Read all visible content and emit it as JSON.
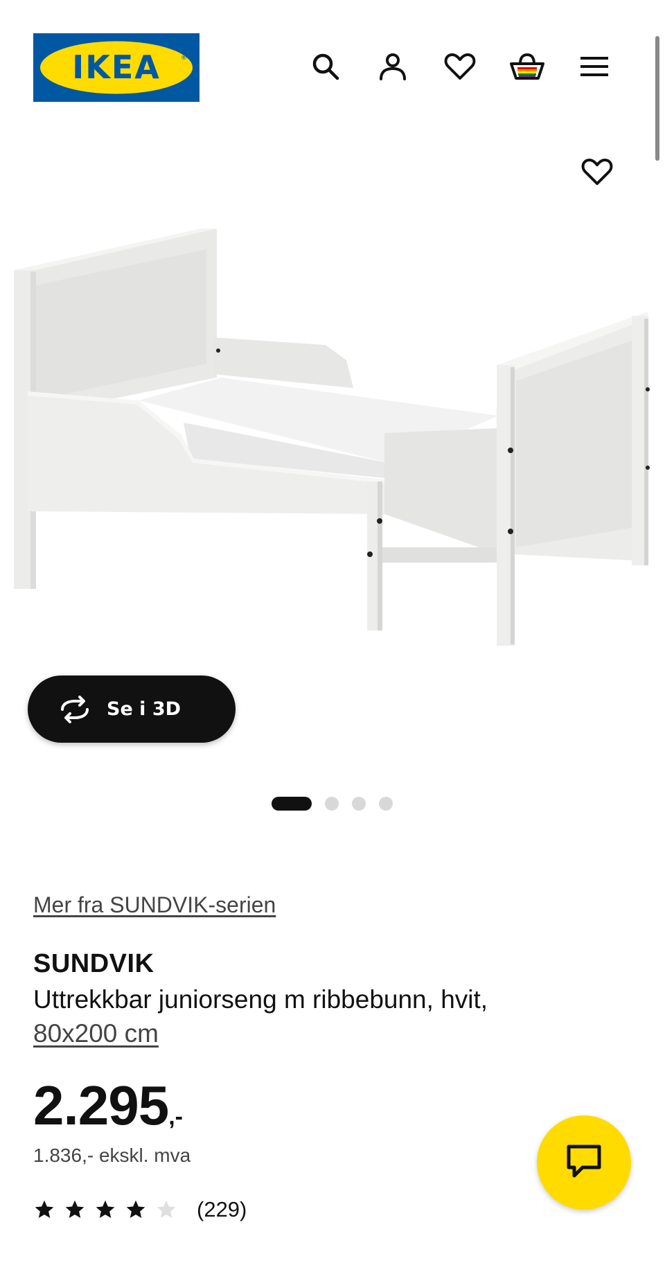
{
  "header": {
    "logo_text": "IKEA",
    "icons": [
      "search-icon",
      "profile-icon",
      "heart-icon",
      "basket-icon",
      "menu-icon"
    ]
  },
  "product": {
    "view_3d_label": "Se i 3D",
    "carousel_count": 4,
    "carousel_active": 1,
    "series_link": "Mer fra SUNDVIK-serien",
    "name": "SUNDVIK",
    "description": "Uttrekkbar juniorseng m ribbebunn, hvit,",
    "size": "80x200 cm",
    "price_int": "2.295",
    "price_suffix": ",-",
    "price_ex_vat": "1.836,- ekskl. mva",
    "rating_value": 4,
    "rating_max": 5,
    "rating_count": "(229)"
  },
  "colors": {
    "ikea_blue": "#0058a3",
    "ikea_yellow": "#ffdb00",
    "text": "#111111"
  }
}
